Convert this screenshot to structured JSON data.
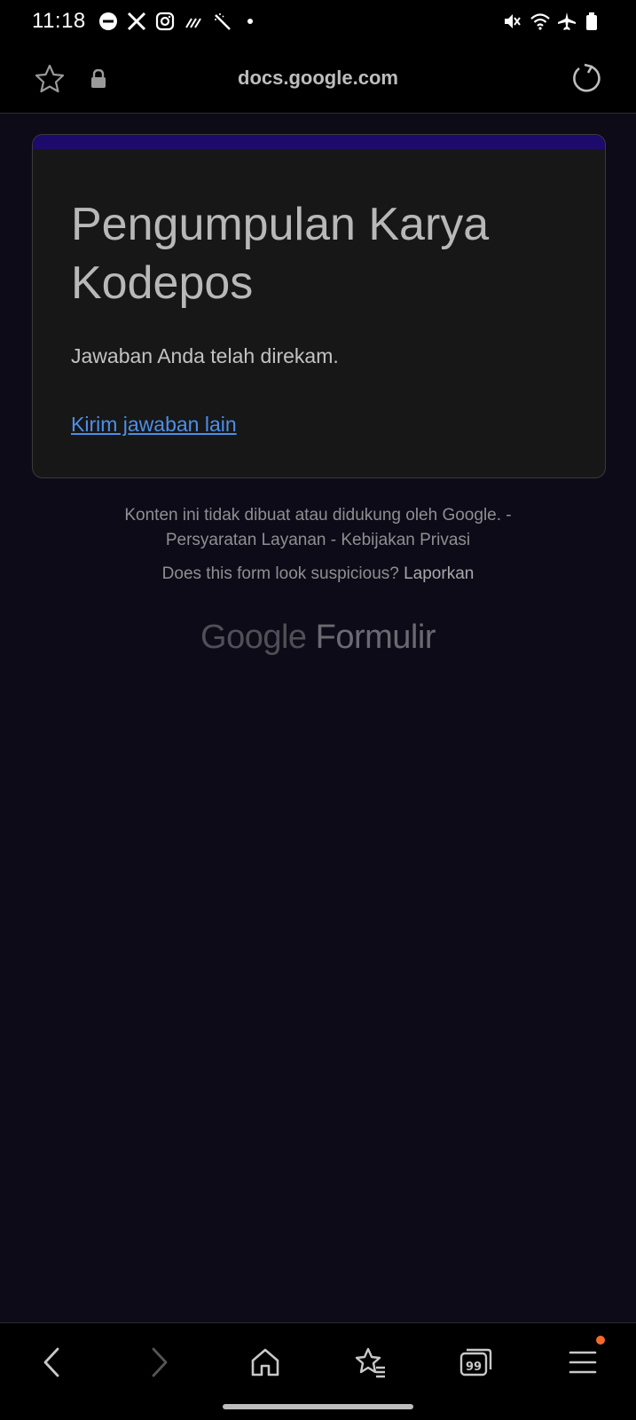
{
  "status_bar": {
    "time": "11:18",
    "left_icons": [
      "do-not-disturb-icon",
      "x-app-icon",
      "instagram-icon",
      "signal-bars-icon",
      "magic-wand-icon",
      "dot-icon"
    ],
    "right_icons": [
      "mute-vibrate-icon",
      "wifi-icon",
      "airplane-icon",
      "battery-icon"
    ]
  },
  "address_bar": {
    "url": "docs.google.com"
  },
  "form": {
    "title": "Pengumpulan Karya Kodepos",
    "confirmation": "Jawaban Anda telah direkam.",
    "submit_another": "Kirim jawaban lain",
    "accent_color": "#1d0b6b"
  },
  "footer": {
    "disclaimer": "Konten ini tidak dibuat atau didukung oleh Google.",
    "sep1": " - ",
    "terms": "Persyaratan Layanan",
    "sep2": " - ",
    "privacy": "Kebijakan Privasi",
    "suspicious": "Does this form look suspicious?",
    "report": "Laporkan",
    "brand_google": "Google",
    "brand_product": "Formulir"
  },
  "bottom_nav": {
    "items": [
      "back-icon",
      "forward-icon",
      "home-icon",
      "bookmarks-icon",
      "tabs-icon",
      "menu-icon"
    ],
    "tabs_count": "99",
    "badge_color": "#f26a2b"
  }
}
